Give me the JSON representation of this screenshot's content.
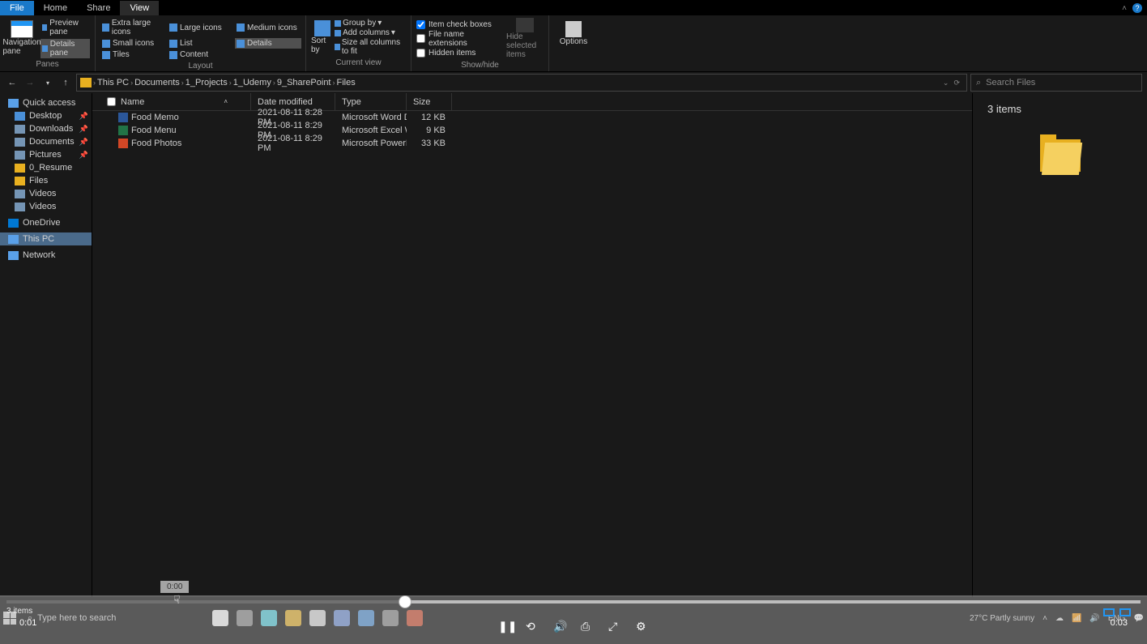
{
  "tabs": {
    "file": "File",
    "home": "Home",
    "share": "Share",
    "view": "View"
  },
  "ribbon": {
    "panes": {
      "nav_label": "Navigation pane",
      "preview": "Preview pane",
      "details": "Details pane",
      "label": "Panes"
    },
    "layout": {
      "extra_large": "Extra large icons",
      "large": "Large icons",
      "medium": "Medium icons",
      "small": "Small icons",
      "list": "List",
      "details": "Details",
      "tiles": "Tiles",
      "content": "Content",
      "label": "Layout"
    },
    "current_view": {
      "sort": "Sort by",
      "group": "Group by",
      "add_cols": "Add columns",
      "size_all": "Size all columns to fit",
      "label": "Current view"
    },
    "showhide": {
      "item_check": "Item check boxes",
      "filename_ext": "File name extensions",
      "hidden_items": "Hidden items",
      "hide_selected": "Hide selected items",
      "label": "Show/hide"
    },
    "options": "Options"
  },
  "breadcrumb": [
    "This PC",
    "Documents",
    "1_Projects",
    "1_Udemy",
    "9_SharePoint",
    "Files"
  ],
  "search": {
    "placeholder": "Search Files"
  },
  "columns": {
    "name": "Name",
    "date": "Date modified",
    "type": "Type",
    "size": "Size"
  },
  "files": [
    {
      "name": "Food Memo",
      "date": "2021-08-11 8:28 PM",
      "type": "Microsoft Word D...",
      "size": "12 KB",
      "icon": "word"
    },
    {
      "name": "Food Menu",
      "date": "2021-08-11 8:29 PM",
      "type": "Microsoft Excel W...",
      "size": "9 KB",
      "icon": "excel"
    },
    {
      "name": "Food Photos",
      "date": "2021-08-11 8:29 PM",
      "type": "Microsoft PowerP...",
      "size": "33 KB",
      "icon": "ppt"
    }
  ],
  "sidebar": {
    "quick_access": "Quick access",
    "desktop": "Desktop",
    "downloads": "Downloads",
    "documents": "Documents",
    "pictures": "Pictures",
    "resume": "0_Resume",
    "files": "Files",
    "videos1": "Videos",
    "videos2": "Videos",
    "onedrive": "OneDrive",
    "thispc": "This PC",
    "network": "Network"
  },
  "rightpane": {
    "count": "3 items"
  },
  "video": {
    "tooltip": "0:00",
    "status": "3 items",
    "time_left": "0:01",
    "time_right": "0:03"
  },
  "taskbar": {
    "search_placeholder": "Type here to search",
    "weather": "27°C  Partly sunny",
    "lang": "ENG"
  }
}
